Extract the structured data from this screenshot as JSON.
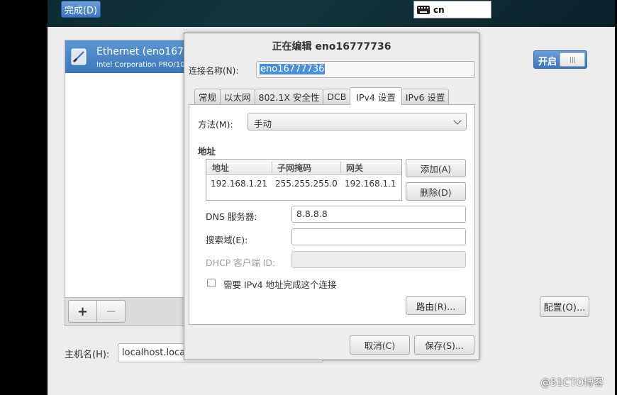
{
  "topbar": {
    "done_label": "完成(D)",
    "keyboard_layout": "cn"
  },
  "devices": {
    "items": [
      {
        "name": "Ethernet (eno167",
        "description": "Intel Corporation PRO/10"
      }
    ],
    "add_label": "+",
    "remove_label": "−"
  },
  "hostname": {
    "label": "主机名(H):",
    "value": "localhost.local"
  },
  "toggle": {
    "label": "开启",
    "state": "on"
  },
  "config_button": "配置(O)...",
  "dialog": {
    "title": "正在编辑 eno16777736",
    "conn_name_label": "连接名称(N):",
    "conn_name_value": "eno16777736",
    "tabs": [
      {
        "label": "常规"
      },
      {
        "label": "以太网"
      },
      {
        "label": "802.1X 安全性"
      },
      {
        "label": "DCB"
      },
      {
        "label": "IPv4 设置",
        "active": true
      },
      {
        "label": "IPv6 设置"
      }
    ],
    "method_label": "方法(M):",
    "method_value": "手动",
    "address_heading": "地址",
    "address_table": {
      "columns": [
        "地址",
        "子网掩码",
        "网关"
      ],
      "rows": [
        [
          "192.168.1.21",
          "255.255.255.0",
          "192.168.1.1"
        ]
      ]
    },
    "add_button": "添加(A)",
    "delete_button": "删除(D)",
    "dns_label": "DNS 服务器:",
    "dns_value": "8.8.8.8",
    "search_label": "搜索域(E):",
    "search_value": "",
    "dhcp_label": "DHCP 客户端 ID:",
    "dhcp_value": "",
    "require_ipv4_label": "需要 IPv4 地址完成这个连接",
    "route_button": "路由(R)...",
    "cancel_button": "取消(C)",
    "save_button": "保存(S)..."
  },
  "watermark": "@51CTO博客",
  "colors": {
    "accent": "#4a86cf",
    "topbar": "#123640"
  }
}
